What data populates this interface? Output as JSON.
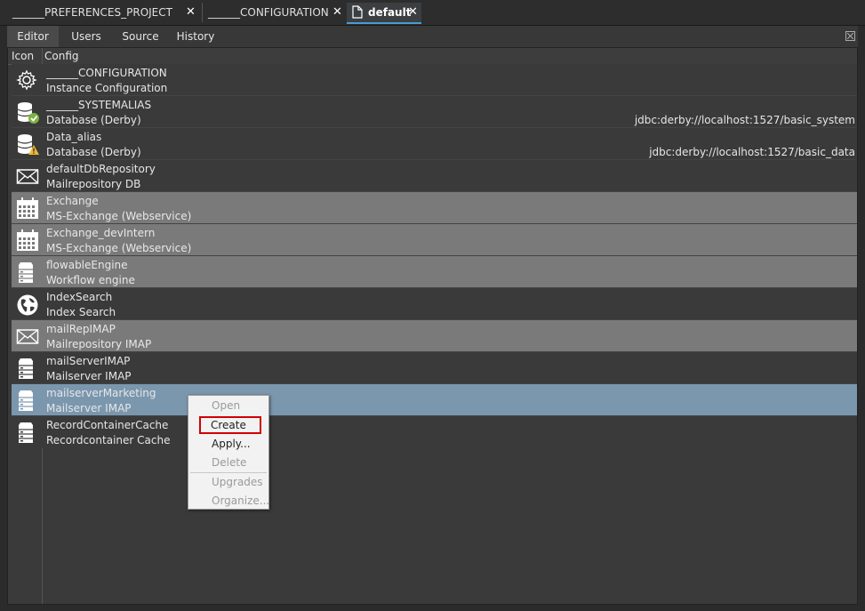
{
  "doc_tabs": [
    {
      "label": "______PREFERENCES_PROJECT",
      "close": "✕"
    },
    {
      "label": "______CONFIGURATION",
      "close": "✕"
    },
    {
      "label": "default",
      "close": "✕"
    }
  ],
  "sub_tabs": [
    "Editor",
    "Users",
    "Source",
    "History"
  ],
  "table": {
    "headers": {
      "icon": "Icon",
      "config": "Config"
    },
    "rows": [
      {
        "icon": "gear-icon",
        "name": "______CONFIGURATION",
        "desc": "Instance Configuration",
        "url": ""
      },
      {
        "icon": "database-check-icon",
        "name": "______SYSTEMALIAS",
        "desc": "Database (Derby)",
        "url": "jdbc:derby://localhost:1527/basic_system"
      },
      {
        "icon": "database-warning-icon",
        "name": "Data_alias",
        "desc": "Database (Derby)",
        "url": "jdbc:derby://localhost:1527/basic_data"
      },
      {
        "icon": "envelope-icon",
        "name": "defaultDbRepository",
        "desc": "Mailrepository DB",
        "url": ""
      },
      {
        "icon": "calendar-icon",
        "name": "Exchange",
        "desc": "MS-Exchange (Webservice)",
        "url": ""
      },
      {
        "icon": "calendar-icon",
        "name": "Exchange_devIntern",
        "desc": "MS-Exchange (Webservice)",
        "url": ""
      },
      {
        "icon": "server-icon",
        "name": "flowableEngine",
        "desc": "Workflow engine",
        "url": ""
      },
      {
        "icon": "globe-icon",
        "name": "IndexSearch",
        "desc": "Index Search",
        "url": ""
      },
      {
        "icon": "envelope-icon",
        "name": "mailRepIMAP",
        "desc": "Mailrepository IMAP",
        "url": ""
      },
      {
        "icon": "server-icon",
        "name": "mailServerIMAP",
        "desc": "Mailserver IMAP",
        "url": ""
      },
      {
        "icon": "server-icon",
        "name": "mailserverMarketing",
        "desc": "Mailserver IMAP",
        "url": ""
      },
      {
        "icon": "server-icon",
        "name": "RecordContainerCache",
        "desc": "Recordcontainer Cache",
        "url": ""
      }
    ]
  },
  "context_menu": {
    "items": [
      {
        "label": "Open",
        "enabled": false
      },
      {
        "label": "Create",
        "enabled": true
      },
      {
        "label": "Apply...",
        "enabled": true
      },
      {
        "label": "Delete",
        "enabled": false
      },
      {
        "label": "Upgrades",
        "enabled": false
      },
      {
        "label": "Organize...",
        "enabled": false
      }
    ]
  },
  "colors": {
    "background": "#2b2b2b",
    "row_highlight": "#7a7a7a",
    "row_selected": "#7a97ae",
    "active_tab_underline": "#4a9bd6",
    "create_outline": "#d00000"
  }
}
